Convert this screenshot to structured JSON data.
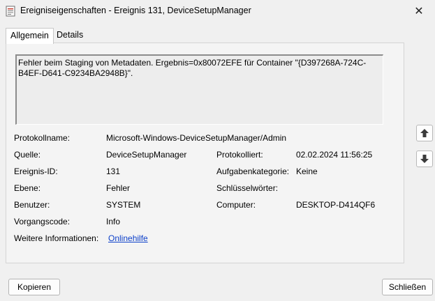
{
  "window": {
    "title": "Ereigniseigenschaften - Ereignis 131, DeviceSetupManager",
    "app_icon": "event-properties-icon",
    "close_glyph": "✕"
  },
  "tabs": [
    {
      "label": "Allgemein",
      "active": true
    },
    {
      "label": "Details",
      "active": false
    }
  ],
  "description": "Fehler beim Staging von Metadaten. Ergebnis=0x80072EFE für Container \"{D397268A-724C-B4EF-D641-C9234BA2948B}\".",
  "fields": {
    "protokollname_label": "Protokollname:",
    "protokollname_value": "Microsoft-Windows-DeviceSetupManager/Admin",
    "quelle_label": "Quelle:",
    "quelle_value": "DeviceSetupManager",
    "protokolliert_label": "Protokolliert:",
    "protokolliert_value": "02.02.2024 11:56:25",
    "ereignis_id_label": "Ereignis-ID:",
    "ereignis_id_value": "131",
    "aufgabenkategorie_label": "Aufgabenkategorie:",
    "aufgabenkategorie_value": "Keine",
    "ebene_label": "Ebene:",
    "ebene_value": "Fehler",
    "schluesselwoerter_label": "Schlüsselwörter:",
    "schluesselwoerter_value": "",
    "benutzer_label": "Benutzer:",
    "benutzer_value": "SYSTEM",
    "computer_label": "Computer:",
    "computer_value": "DESKTOP-D414QF6",
    "vorgangscode_label": "Vorgangscode:",
    "vorgangscode_value": "Info",
    "weitere_label": "Weitere Informationen:",
    "weitere_link": "Onlinehilfe"
  },
  "side_buttons": {
    "up_icon": "arrow-up-icon",
    "down_icon": "arrow-down-icon"
  },
  "buttons": {
    "copy_label": "Kopieren",
    "close_label": "Schließen"
  }
}
